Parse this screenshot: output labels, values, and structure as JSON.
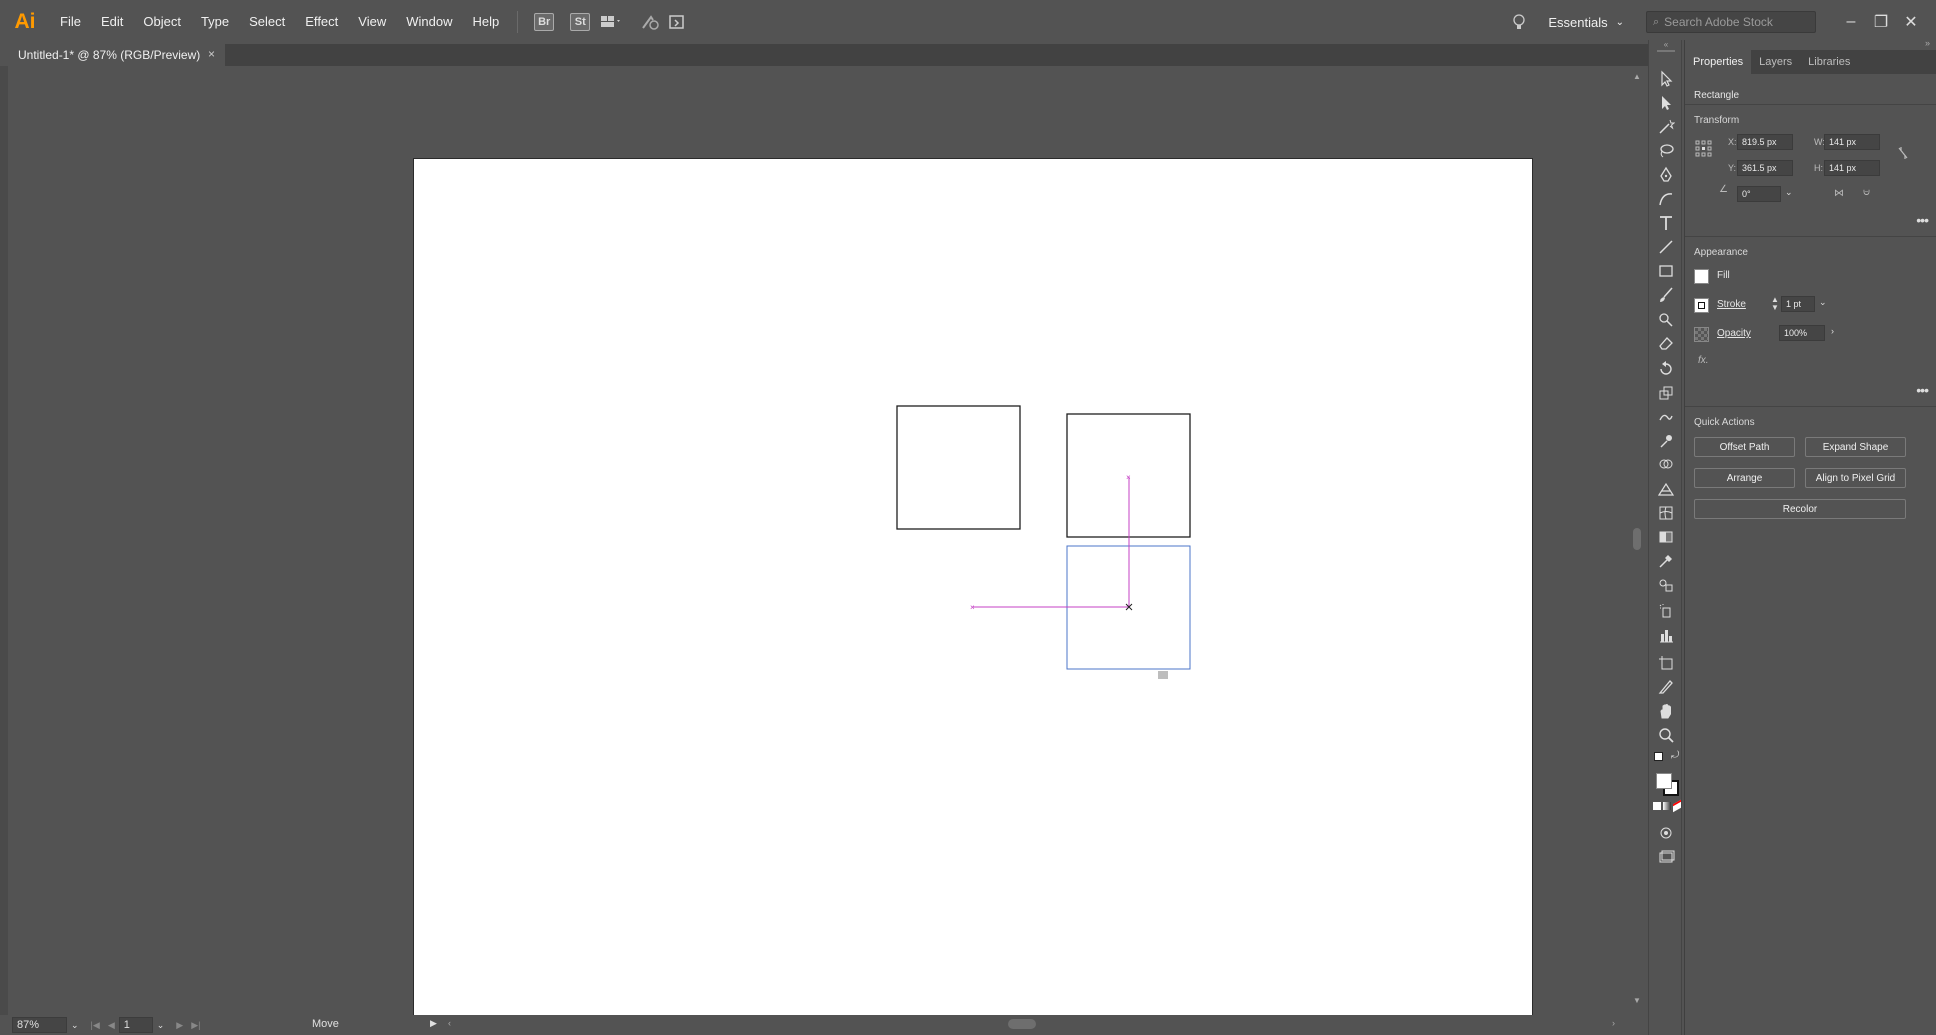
{
  "app": {
    "logo": "Ai",
    "menu": [
      "File",
      "Edit",
      "Object",
      "Type",
      "Select",
      "Effect",
      "View",
      "Window",
      "Help"
    ],
    "bridge_label": "Br",
    "stock_label": "St",
    "workspace": "Essentials",
    "search_placeholder": "Search Adobe Stock"
  },
  "document": {
    "tab_title": "Untitled-1* @ 87% (RGB/Preview)",
    "close": "×"
  },
  "status": {
    "zoom": "87%",
    "page": "1",
    "tool_status": "Move"
  },
  "panel": {
    "tabs": [
      "Properties",
      "Layers",
      "Libraries"
    ],
    "active_tab": "Properties",
    "selection_type": "Rectangle",
    "transform": {
      "title": "Transform",
      "x_label": "X:",
      "x_value": "819.5 px",
      "y_label": "Y:",
      "y_value": "361.5 px",
      "w_label": "W:",
      "w_value": "141 px",
      "h_label": "H:",
      "h_value": "141 px",
      "angle_value": "0°"
    },
    "appearance": {
      "title": "Appearance",
      "fill_label": "Fill",
      "stroke_label": "Stroke",
      "stroke_value": "1 pt",
      "opacity_label": "Opacity",
      "opacity_value": "100%",
      "fx_label": "fx."
    },
    "quick_actions": {
      "title": "Quick Actions",
      "offset_path": "Offset Path",
      "expand_shape": "Expand Shape",
      "arrange": "Arrange",
      "align_pixel_grid": "Align to Pixel Grid",
      "recolor": "Recolor"
    }
  },
  "colors": {
    "selection": "#4b74c9",
    "smart_guide": "#c441c4",
    "app_logo": "#ff9a00"
  }
}
